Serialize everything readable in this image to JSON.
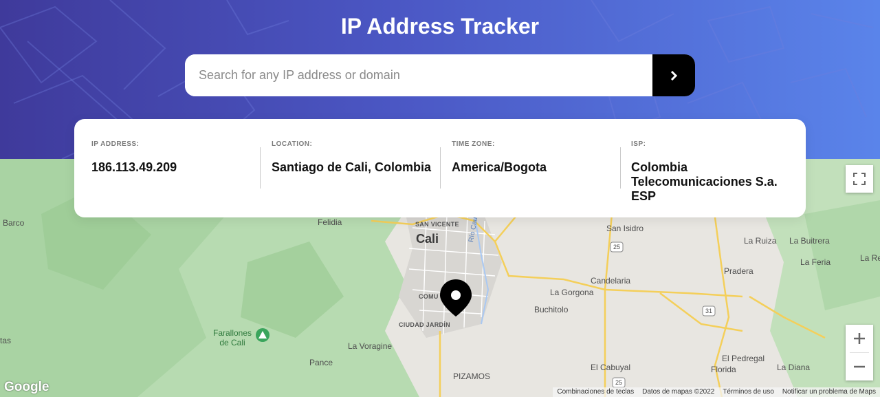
{
  "header": {
    "title": "IP Address Tracker"
  },
  "search": {
    "placeholder": "Search for any IP address or domain",
    "value": ""
  },
  "info": {
    "ip": {
      "label": "IP Address:",
      "value": "186.113.49.209"
    },
    "location": {
      "label": "Location:",
      "value": "Santiago de Cali, Colombia"
    },
    "timezone": {
      "label": "Time Zone:",
      "value": "America/Bogota"
    },
    "isp": {
      "label": "ISP:",
      "value": "Colombia Telecomunicaciones S.a. ESP"
    }
  },
  "map": {
    "places": {
      "barco": "Barco",
      "felidia": "Felidia",
      "san_vicente": "SAN VICENTE",
      "cali": "Cali",
      "rio_cauca": "Río Cauca",
      "san_isidro": "San Isidro",
      "la_ruiza": "La Ruiza",
      "la_buitrera": "La Buitrera",
      "la_feria": "La Feria",
      "la_re": "La Re",
      "pradera": "Pradera",
      "candelaria": "Candelaria",
      "la_gorgona": "La Gorgona",
      "comuna": "COMU",
      "ciudad_jardin": "CIUDAD JARDÍN",
      "buchitolo": "Buchitolo",
      "farallones": "Farallones de Cali",
      "tas": "tas",
      "la_voragine": "La Voragine",
      "pance": "Pance",
      "pizamos": "PIZAMOS",
      "el_cabuyal": "El Cabuyal",
      "el_pedregal": "El Pedregal",
      "la_diana": "La Diana",
      "florida": "Florida"
    },
    "routes": {
      "r25a": "25",
      "r31": "31",
      "r25b": "25"
    },
    "google": "Google",
    "footer": {
      "shortcuts": "Combinaciones de teclas",
      "data": "Datos de mapas ©2022",
      "terms": "Términos de uso",
      "report": "Notificar un problema de Maps"
    },
    "colors": {
      "park": "#b8dcb4",
      "land": "#e8e6e1",
      "road": "#f6d56b"
    }
  }
}
